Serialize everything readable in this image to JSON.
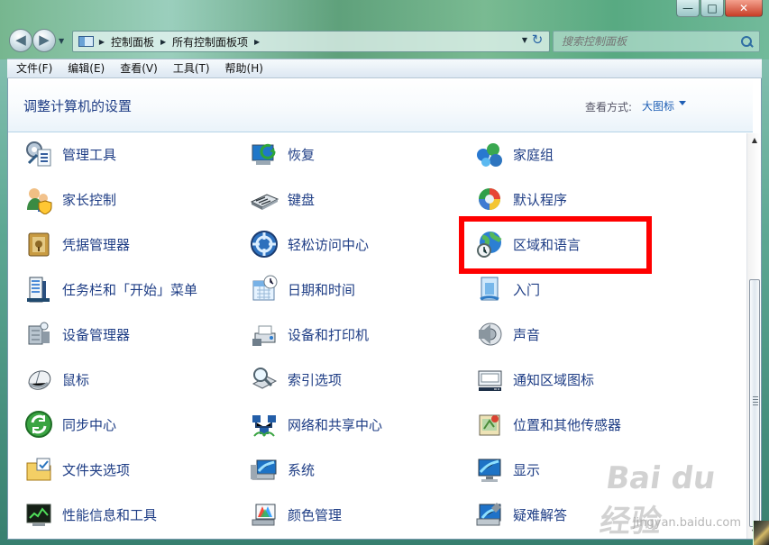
{
  "window": {
    "background_hint": "Tabs"
  },
  "title_controls": {
    "minimize": "—",
    "maximize": "□",
    "close": "✕"
  },
  "address": {
    "crumbs": [
      "控制面板",
      "所有控制面板项"
    ],
    "refresh_icon": "refresh-icon"
  },
  "search": {
    "placeholder": "搜索控制面板"
  },
  "menu": {
    "items": [
      "文件(F)",
      "编辑(E)",
      "查看(V)",
      "工具(T)",
      "帮助(H)"
    ]
  },
  "header": {
    "title": "调整计算机的设置",
    "view_label": "查看方式:",
    "view_value": "大图标"
  },
  "items": [
    {
      "label": "管理工具",
      "icon": "admin-tools-icon"
    },
    {
      "label": "恢复",
      "icon": "recovery-icon"
    },
    {
      "label": "家庭组",
      "icon": "homegroup-icon"
    },
    {
      "label": "家长控制",
      "icon": "parental-controls-icon"
    },
    {
      "label": "键盘",
      "icon": "keyboard-icon"
    },
    {
      "label": "默认程序",
      "icon": "default-programs-icon"
    },
    {
      "label": "凭据管理器",
      "icon": "credential-manager-icon"
    },
    {
      "label": "轻松访问中心",
      "icon": "ease-of-access-icon"
    },
    {
      "label": "区域和语言",
      "icon": "region-language-icon"
    },
    {
      "label": "任务栏和「开始」菜单",
      "icon": "taskbar-start-menu-icon"
    },
    {
      "label": "日期和时间",
      "icon": "date-time-icon"
    },
    {
      "label": "入门",
      "icon": "getting-started-icon"
    },
    {
      "label": "设备管理器",
      "icon": "device-manager-icon"
    },
    {
      "label": "设备和打印机",
      "icon": "devices-printers-icon"
    },
    {
      "label": "声音",
      "icon": "sound-icon"
    },
    {
      "label": "鼠标",
      "icon": "mouse-icon"
    },
    {
      "label": "索引选项",
      "icon": "indexing-options-icon"
    },
    {
      "label": "通知区域图标",
      "icon": "notification-area-icon"
    },
    {
      "label": "同步中心",
      "icon": "sync-center-icon"
    },
    {
      "label": "网络和共享中心",
      "icon": "network-sharing-icon"
    },
    {
      "label": "位置和其他传感器",
      "icon": "location-sensors-icon"
    },
    {
      "label": "文件夹选项",
      "icon": "folder-options-icon"
    },
    {
      "label": "系统",
      "icon": "system-icon"
    },
    {
      "label": "显示",
      "icon": "display-icon"
    },
    {
      "label": "性能信息和工具",
      "icon": "performance-icon"
    },
    {
      "label": "颜色管理",
      "icon": "color-management-icon"
    },
    {
      "label": "疑难解答",
      "icon": "troubleshooting-icon"
    }
  ],
  "watermark": {
    "logo": "Bai du 经验",
    "url": "jingyan.baidu.com"
  },
  "colors": {
    "link_blue": "#1e3d85",
    "highlight_red": "#ff0000"
  }
}
